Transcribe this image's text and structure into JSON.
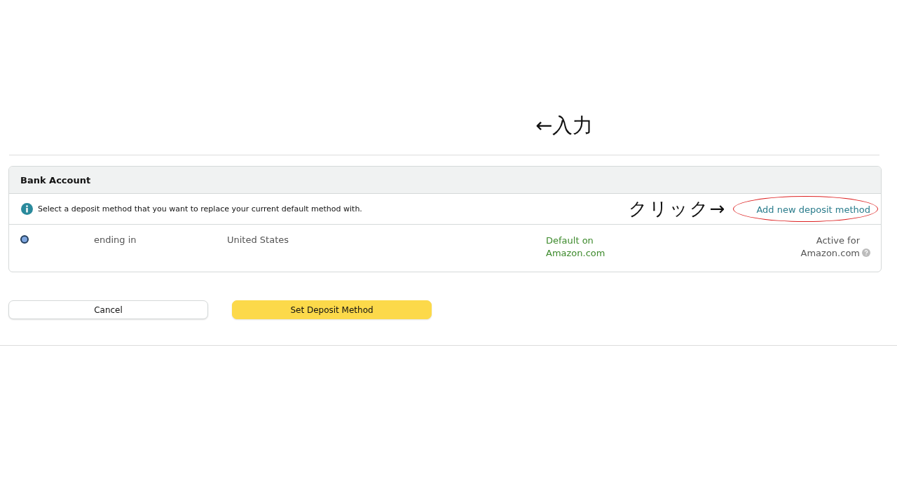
{
  "input_annotation": "←入力",
  "bank_account": {
    "title": "Bank Account",
    "info": "Select a deposit method that you want to replace your current default method with.",
    "click_annotation": "クリック→",
    "add_link": "Add new deposit method",
    "methods": [
      {
        "selected": true,
        "ending": "ending in",
        "country": "United States",
        "default_status": "Default on Amazon.com",
        "active_status": "Active for Amazon.com"
      }
    ]
  },
  "buttons": [
    {
      "label": "Cancel",
      "kind": "secondary"
    },
    {
      "label": "Set Deposit Method",
      "kind": "primary"
    }
  ]
}
